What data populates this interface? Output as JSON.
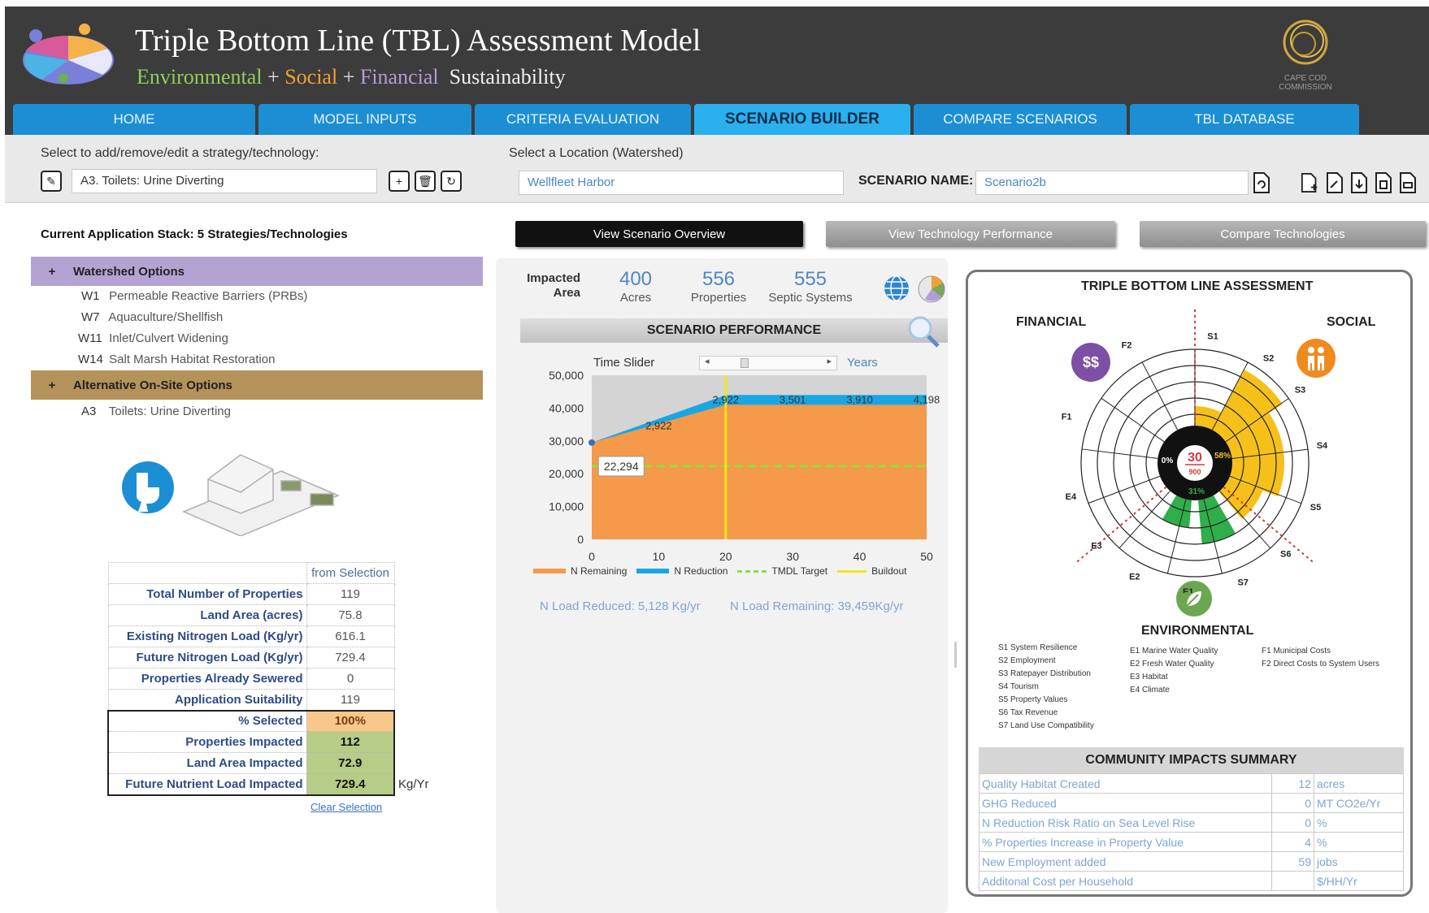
{
  "header": {
    "title": "Triple Bottom Line (TBL) Assessment Model",
    "subtitle_env": "Environmental",
    "subtitle_plus": "+",
    "subtitle_soc": "Social",
    "subtitle_fin": "Financial",
    "subtitle_sus": "Sustainability",
    "org_logo_text": "CAPE COD COMMISSION"
  },
  "nav": {
    "tabs": [
      "HOME",
      "MODEL INPUTS",
      "CRITERIA EVALUATION",
      "SCENARIO BUILDER",
      "COMPARE SCENARIOS",
      "TBL DATABASE"
    ],
    "active": "SCENARIO BUILDER"
  },
  "toolbar": {
    "strategy_label": "Select to add/remove/edit a strategy/technology:",
    "strategy_value": "A3. Toilets: Urine Diverting",
    "location_label": "Select a Location (Watershed)",
    "location_value": "Wellfleet Harbor",
    "scenario_name_label": "SCENARIO NAME:",
    "scenario_name_value": "Scenario2b"
  },
  "stack": {
    "title": "Current Application Stack: 5 Strategies/Technologies",
    "groups": [
      {
        "label": "Watershed Options",
        "color": "#b3a3d3",
        "items": [
          {
            "code": "W1",
            "name": "Permeable Reactive Barriers (PRBs)"
          },
          {
            "code": "W7",
            "name": "Aquaculture/Shellfish"
          },
          {
            "code": "W11",
            "name": "Inlet/Culvert Widening"
          },
          {
            "code": "W14",
            "name": "Salt Marsh Habitat Restoration"
          }
        ]
      },
      {
        "label": "Alternative On-Site Options",
        "color": "#b4925a",
        "items": [
          {
            "code": "A3",
            "name": "Toilets: Urine Diverting"
          }
        ]
      }
    ]
  },
  "selection_table": {
    "header": "from Selection",
    "rows": [
      {
        "label": "Total Number of Properties",
        "value": "119"
      },
      {
        "label": "Land Area (acres)",
        "value": "75.8"
      },
      {
        "label": "Existing Nitrogen Load (Kg/yr)",
        "value": "616.1"
      },
      {
        "label": "Future Nitrogen Load (Kg/yr)",
        "value": "729.4"
      },
      {
        "label": "Properties Already Sewered",
        "value": "0"
      },
      {
        "label": "Application Suitability",
        "value": "119"
      },
      {
        "label": "% Selected",
        "value": "100%"
      },
      {
        "label": "Properties Impacted",
        "value": "112"
      },
      {
        "label": "Land Area Impacted",
        "value": "72.9"
      },
      {
        "label": "Future Nutrient Load Impacted",
        "value": "729.4"
      }
    ],
    "unit": "Kg/Yr",
    "clear_link": "Clear Selection"
  },
  "actions": {
    "overview": "View Scenario Overview",
    "performance": "View Technology Performance",
    "compare": "Compare Technologies"
  },
  "impacted": {
    "label_line1": "Impacted",
    "label_line2": "Area",
    "acres": "400",
    "acres_unit": "Acres",
    "properties": "556",
    "properties_unit": "Properties",
    "septic": "555",
    "septic_unit": "Septic Systems"
  },
  "performance": {
    "title": "SCENARIO PERFORMANCE",
    "time_slider_label": "Time Slider",
    "years_label": "Years",
    "load_reduced": "N Load Reduced: 5,128 Kg/yr",
    "load_remaining": "N Load Remaining: 39,459Kg/yr"
  },
  "chart_data": {
    "type": "area",
    "x": [
      0,
      20,
      30,
      40,
      50
    ],
    "xticks": [
      0,
      10,
      20,
      30,
      40,
      50
    ],
    "yticks": [
      "0",
      "10,000",
      "20,000",
      "30,000",
      "40,000",
      "50,000"
    ],
    "ylim": [
      0,
      50000
    ],
    "series": [
      {
        "name": "N Remaining",
        "values": [
          29500,
          41000,
          41000,
          41000,
          41000
        ],
        "color": "#f5994a"
      },
      {
        "name": "N Reduction",
        "values": [
          29500,
          44000,
          44000,
          44000,
          44000
        ],
        "color": "#1aa6e4"
      },
      {
        "name": "TMDL Target",
        "constant": 22294,
        "color": "#8fe03a"
      },
      {
        "name": "Buildout",
        "at_x": 20,
        "color": "#f2e51d"
      }
    ],
    "background_top": 50000,
    "data_labels": [
      {
        "text": "2,922",
        "x": 10,
        "y": 33500
      },
      {
        "text": "2,922",
        "x": 20,
        "y": 41500
      },
      {
        "text": "3,501",
        "x": 30,
        "y": 41500
      },
      {
        "text": "3,910",
        "x": 40,
        "y": 41500
      },
      {
        "text": "4,198",
        "x": 50,
        "y": 41500
      }
    ],
    "target_label": "22,294"
  },
  "tbl": {
    "title": "TRIPLE BOTTOM LINE ASSESSMENT",
    "financial": "FINANCIAL",
    "social": "SOCIAL",
    "environmental": "ENVIRONMENTAL",
    "center_value": "30",
    "center_total": "900",
    "ring_labels": [
      "0%",
      "58%",
      "31%"
    ],
    "axis_labels": [
      "S1",
      "S2",
      "S3",
      "S4",
      "S5",
      "S6",
      "S7",
      "E1",
      "E2",
      "E3",
      "E4",
      "F1",
      "F2"
    ],
    "legend_s": [
      "S1  System Resilience",
      "S2  Employment",
      "S3  Ratepayer Distribution",
      "S4  Tourism",
      "S5  Property Values",
      "S6  Tax Revenue",
      "S7  Land Use Compatibility"
    ],
    "legend_e": [
      "E1  Marine Water Quality",
      "E2  Fresh Water Quality",
      "E3  Habitat",
      "E4  Climate"
    ],
    "legend_f": [
      "F1  Municipal Costs",
      "F2  Direct Costs to System Users"
    ]
  },
  "community": {
    "title": "COMMUNITY IMPACTS SUMMARY",
    "rows": [
      {
        "label": "Quality Habitat Created",
        "value": "12",
        "unit": "acres"
      },
      {
        "label": "GHG Reduced",
        "value": "0",
        "unit": "MT CO2e/Yr"
      },
      {
        "label": "N Reduction Risk Ratio on Sea Level Rise",
        "value": "0",
        "unit": "%"
      },
      {
        "label": "% Properties Increase in Property Value",
        "value": "4",
        "unit": "%"
      },
      {
        "label": "New Employment added",
        "value": "59",
        "unit": "jobs"
      },
      {
        "label": "Additonal Cost per Household",
        "value": "",
        "unit": "$/HH/Yr"
      }
    ]
  },
  "icons": {
    "dollar_badge": "$$",
    "colors": {
      "financial": "#7d4fa5",
      "social": "#f08a1e",
      "environmental": "#6aa84f",
      "accent_blue": "#1c8fd4"
    }
  }
}
